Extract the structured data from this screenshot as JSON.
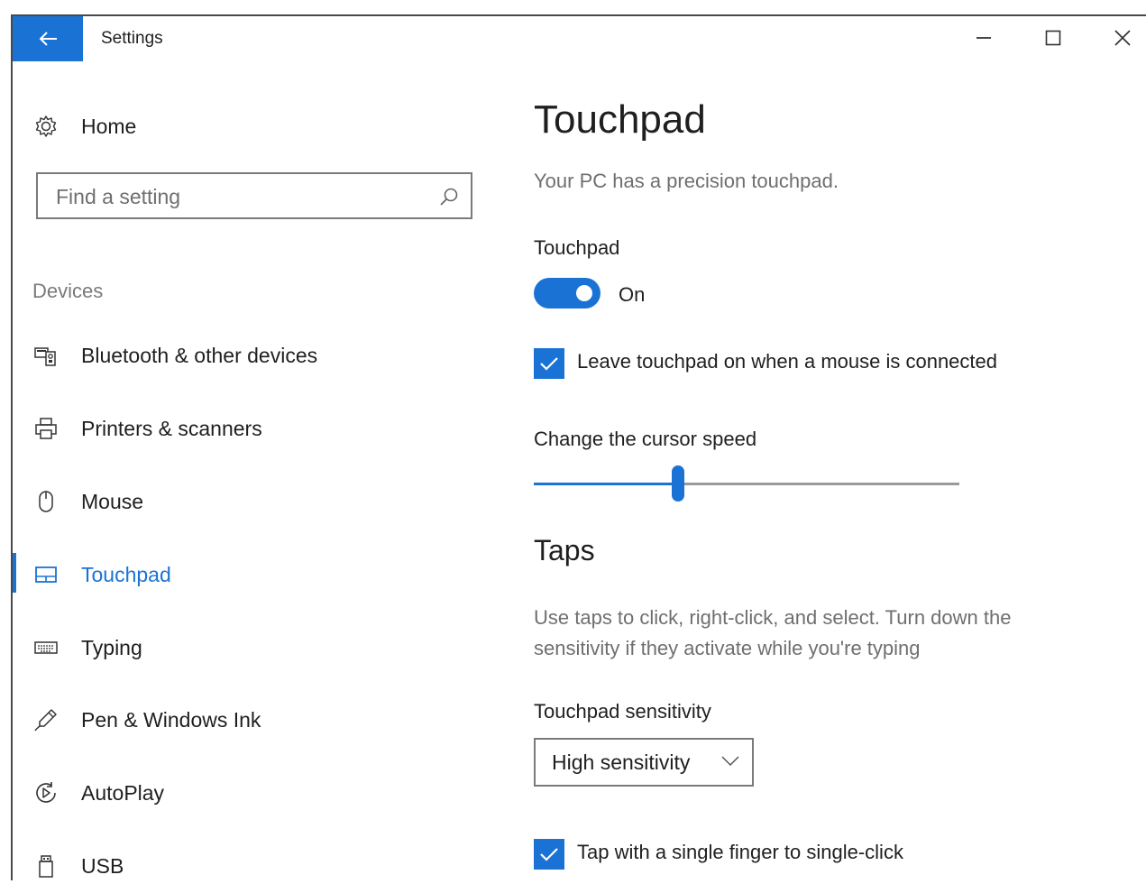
{
  "window": {
    "title": "Settings",
    "controls": [
      "minimize",
      "maximize",
      "close"
    ]
  },
  "sidebar": {
    "home_label": "Home",
    "search_placeholder": "Find a setting",
    "group_label": "Devices",
    "items": [
      {
        "label": "Bluetooth & other devices",
        "icon": "bluetooth-devices-icon"
      },
      {
        "label": "Printers & scanners",
        "icon": "printer-icon"
      },
      {
        "label": "Mouse",
        "icon": "mouse-icon"
      },
      {
        "label": "Touchpad",
        "icon": "touchpad-icon",
        "active": true
      },
      {
        "label": "Typing",
        "icon": "keyboard-icon"
      },
      {
        "label": "Pen & Windows Ink",
        "icon": "pen-icon"
      },
      {
        "label": "AutoPlay",
        "icon": "autoplay-icon"
      },
      {
        "label": "USB",
        "icon": "usb-icon"
      }
    ]
  },
  "main": {
    "title": "Touchpad",
    "subtitle": "Your PC has a precision touchpad.",
    "touchpad_label": "Touchpad",
    "toggle_state": "On",
    "leave_on_label": "Leave touchpad on when a mouse is connected",
    "leave_on_checked": true,
    "cursor_speed_label": "Change the cursor speed",
    "cursor_speed_fraction": 0.34,
    "taps_heading": "Taps",
    "taps_desc_line1": "Use taps to click, right-click, and select. Turn down the",
    "taps_desc_line2": "sensitivity if they activate while you're typing",
    "sensitivity_label": "Touchpad sensitivity",
    "sensitivity_value": "High sensitivity",
    "single_tap_label": "Tap with a single finger to single-click",
    "single_tap_checked": true
  },
  "colors": {
    "accent": "#1a73d4",
    "text": "#1f1f1f",
    "secondary_text": "#6f6f6f"
  }
}
